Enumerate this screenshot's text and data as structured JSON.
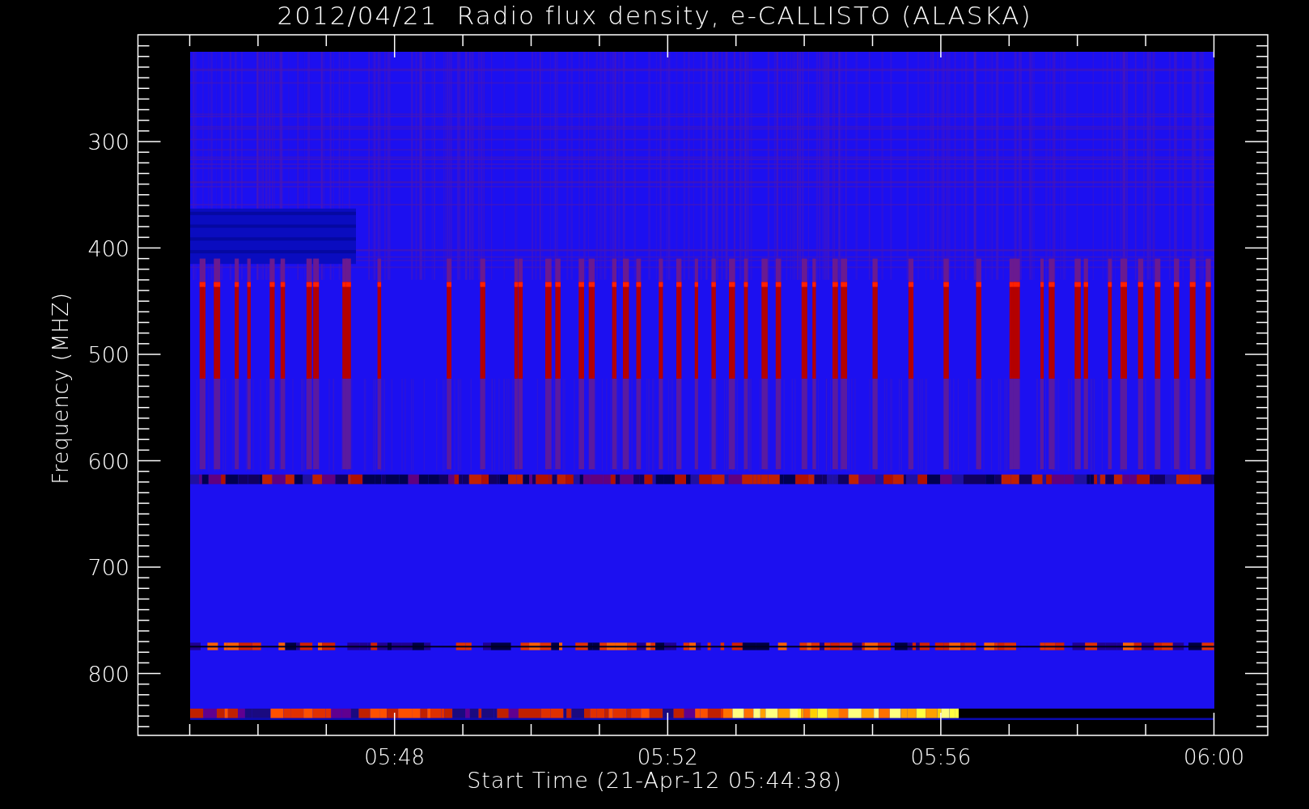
{
  "title": "2012/04/21  Radio flux density, e-CALLISTO (ALASKA)",
  "y_axis": {
    "label": "Frequency (MHZ)",
    "tick_labels": [
      "300",
      "400",
      "500",
      "600",
      "700",
      "800"
    ]
  },
  "x_axis": {
    "label": "Start Time (21-Apr-12 05:44:38)",
    "tick_labels": [
      "05:48",
      "05:52",
      "05:56",
      "06:00"
    ]
  }
}
